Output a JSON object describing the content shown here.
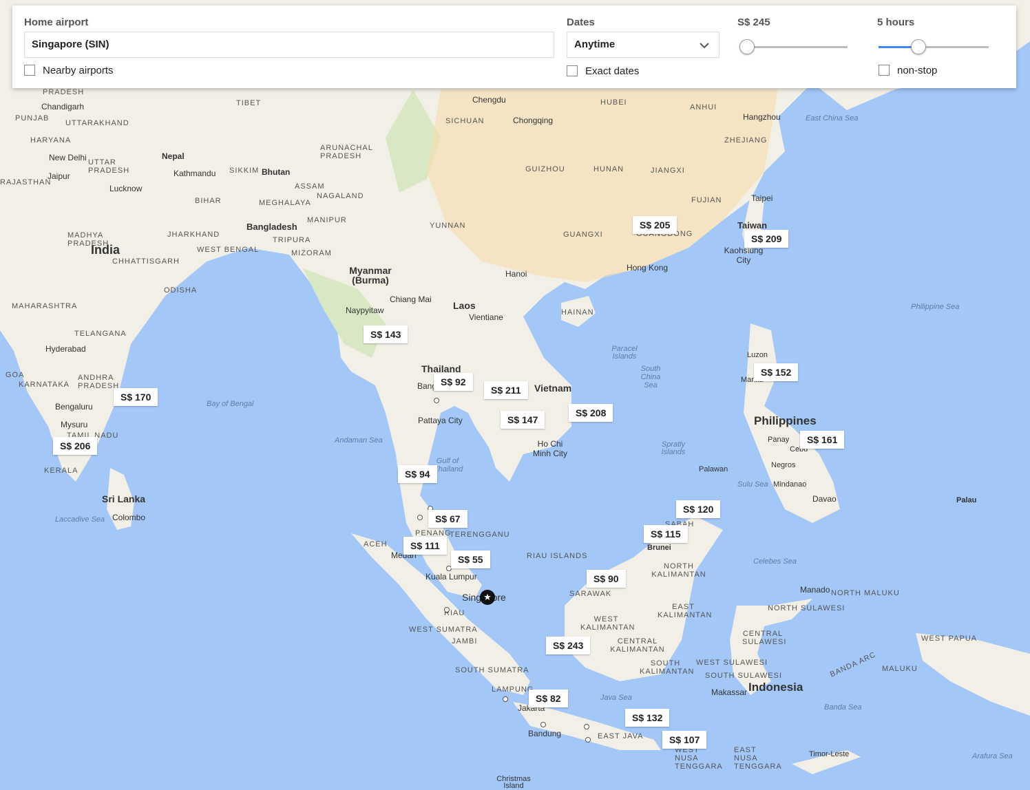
{
  "controls": {
    "home_airport_label": "Home airport",
    "home_airport_value": "Singapore (SIN)",
    "nearby_label": "Nearby airports",
    "dates_label": "Dates",
    "dates_value": "Anytime",
    "exact_dates_label": "Exact dates",
    "price_label": "S$ 245",
    "price_slider_fraction": 0.0,
    "duration_label": "5 hours",
    "duration_slider_fraction": 0.36,
    "nonstop_label": "non-stop"
  },
  "prices": [
    "S$ 205",
    "S$ 209",
    "S$ 143",
    "S$ 92",
    "S$ 211",
    "S$ 147",
    "S$ 208",
    "S$ 152",
    "S$ 161",
    "S$ 170",
    "S$ 206",
    "S$ 94",
    "S$ 67",
    "S$ 111",
    "S$ 55",
    "S$ 120",
    "S$ 115",
    "S$ 90",
    "S$ 243",
    "S$ 82",
    "S$ 132",
    "S$ 107"
  ],
  "countries": [
    "India",
    "Myanmar (Burma)",
    "Laos",
    "Thailand",
    "Vietnam",
    "Philippines",
    "Indonesia",
    "Bangladesh",
    "Nepal",
    "Bhutan",
    "Taiwan",
    "Sri Lanka",
    "Brunei"
  ],
  "places": [
    "New Delhi",
    "Jaipur",
    "Lucknow",
    "Kathmandu",
    "Chandigarh",
    "Chengdu",
    "Chongqing",
    "Hangzhou",
    "Taipei",
    "Hong Kong",
    "Hanoi",
    "Kaohsiung City",
    "Chiang Mai",
    "Naypyitaw",
    "Vientiane",
    "Bangkok",
    "Pattaya City",
    "Ho Chi Minh City",
    "Hyderabad",
    "Bengaluru",
    "Mysuru",
    "Colombo",
    "Kuala Lumpur",
    "Medan",
    "Singapore",
    "Jakarta",
    "Bandung",
    "Makassar",
    "Manado",
    "Davao",
    "Mindanao",
    "Negros",
    "Panay",
    "Palawan",
    "Cebu",
    "Manila",
    "Luzon",
    "Timor-Leste",
    "Palau",
    "Christmas Island"
  ],
  "regions": [
    "PRADESH",
    "PUNJAB",
    "UTTARAKHAND",
    "HARYANA",
    "UTTAR PRADESH",
    "RAJASTHAN",
    "TIBET",
    "SIKKIM",
    "ASSAM",
    "NAGALAND",
    "ARUNACHAL PRADESH",
    "MEGHALAYA",
    "MANIPUR",
    "TRIPURA",
    "MIZORAM",
    "BIHAR",
    "JHARKHAND",
    "WEST BENGAL",
    "MADHYA PRADESH",
    "CHHATTISGARH",
    "ODISHA",
    "MAHARASHTRA",
    "TELANGANA",
    "ANDHRA PRADESH",
    "KARNATAKA",
    "GOA",
    "TAMIL NADU",
    "KERALA",
    "SICHUAN",
    "HUBEI",
    "ANHUI",
    "ZHEJIANG",
    "GUIZHOU",
    "HUNAN",
    "JIANGXI",
    "FUJIAN",
    "YUNNAN",
    "GUANGXI",
    "GUANGDONG",
    "HAINAN",
    "ACEH",
    "PENANG",
    "TERENGGANU",
    "RIAU ISLANDS",
    "RIAU",
    "WEST SUMATRA",
    "JAMBI",
    "SOUTH SUMATRA",
    "LAMPUNG",
    "EAST JAVA",
    "SABAH",
    "SARAWAK",
    "NORTH KALIMANTAN",
    "EAST KALIMANTAN",
    "WEST KALIMANTAN",
    "CENTRAL KALIMANTAN",
    "SOUTH KALIMANTAN",
    "NORTH SULAWESI",
    "CENTRAL SULAWESI",
    "WEST SULAWESI",
    "SOUTH SULAWESI",
    "NORTH MALUKU",
    "MALUKU",
    "WEST PAPUA",
    "WEST NUSA TENGGARA",
    "EAST NUSA TENGGARA",
    "BANDA ARC"
  ],
  "seas": [
    "East China Sea",
    "Philippine Sea",
    "Bay of Bengal",
    "Andaman Sea",
    "Gulf of Thailand",
    "South China Sea",
    "Paracel Islands",
    "Spratly Islands",
    "Sulu Sea",
    "Celebes Sea",
    "Java Sea",
    "Banda Sea",
    "Arafura Sea",
    "Laccadive Sea"
  ]
}
